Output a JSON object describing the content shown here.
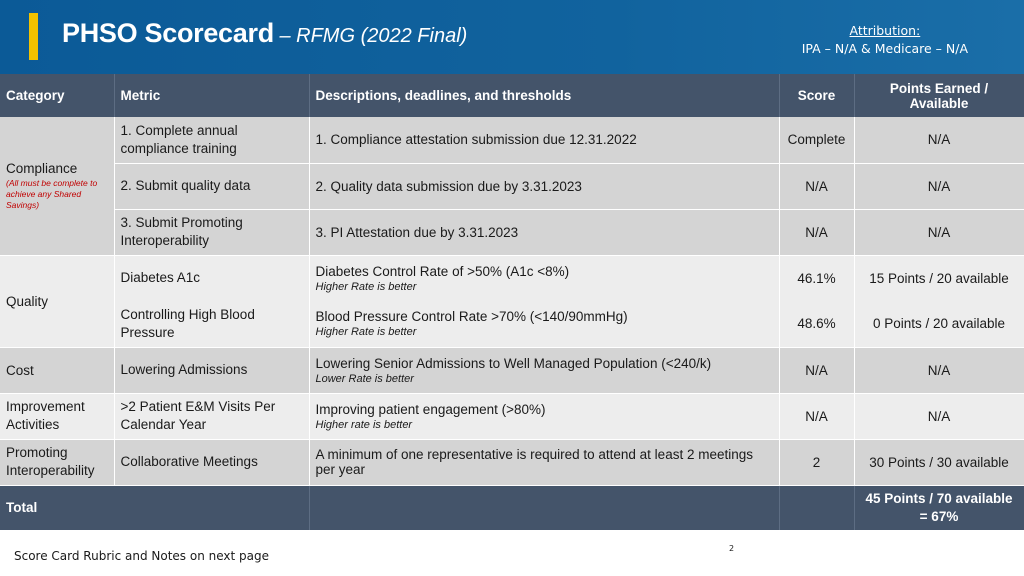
{
  "header": {
    "title_main": "PHSO Scorecard",
    "title_sub": " – RFMG (2022 Final)",
    "attribution_label": "Attribution:",
    "attribution_value": "IPA – N/A & Medicare – N/A",
    "colors": {
      "background": "#0f5e9a",
      "accent": "#f2c200"
    }
  },
  "table": {
    "columns": [
      "Category",
      "Metric",
      "Descriptions, deadlines, and thresholds",
      "Score",
      "Points Earned / Available"
    ],
    "rows": [
      {
        "category": "Compliance",
        "category_note": "(All must be complete to achieve any Shared Savings)",
        "metric": "1. Complete annual compliance training",
        "description": "1. Compliance attestation submission due 12.31.2022",
        "description_note": "",
        "score": "Complete",
        "points": "N/A"
      },
      {
        "category": "",
        "category_note": "",
        "metric": "2. Submit quality data",
        "description": "2. Quality data submission due by 3.31.2023",
        "description_note": "",
        "score": "N/A",
        "points": "N/A"
      },
      {
        "category": "",
        "category_note": "",
        "metric": "3. Submit Promoting Interoperability",
        "description": "3. PI Attestation due by 3.31.2023",
        "description_note": "",
        "score": "N/A",
        "points": "N/A"
      },
      {
        "category": "Quality",
        "category_note": "",
        "metric": "Diabetes A1c",
        "description": "Diabetes Control Rate of >50% (A1c <8%)",
        "description_note": "Higher Rate is better",
        "score": "46.1%",
        "points": "15 Points / 20 available"
      },
      {
        "category": "",
        "category_note": "",
        "metric": "Controlling High Blood Pressure",
        "description": "Blood Pressure Control Rate  >70% (<140/90mmHg)",
        "description_note": "Higher Rate is better",
        "score": "48.6%",
        "points": "0 Points  / 20 available"
      },
      {
        "category": "Cost",
        "category_note": "",
        "metric": " Lowering Admissions",
        "description": "Lowering Senior Admissions to Well Managed Population (<240/k)",
        "description_note": "Lower Rate is better",
        "score": "N/A",
        "points": "N/A"
      },
      {
        "category": "Improvement Activities",
        "category_note": "",
        "metric": " >2 Patient E&M Visits Per Calendar Year",
        "description": "Improving patient engagement (>80%)",
        "description_note": "Higher rate is better",
        "score": "N/A",
        "points": "N/A"
      },
      {
        "category": "Promoting Interoperability",
        "category_note": "",
        "metric": "Collaborative Meetings",
        "description": "A minimum of one representative is required to attend at least 2 meetings per year",
        "description_note": "",
        "score": "2",
        "points": "30 Points / 30 available"
      }
    ],
    "total": {
      "label": "Total",
      "points": "45 Points / 70 available = 67%"
    },
    "colors": {
      "header": "#44546a",
      "row_gray": "#d4d4d4",
      "row_light": "#ededed",
      "note_red": "#c00000"
    }
  },
  "footer": {
    "note": "Score Card Rubric and Notes on next page",
    "page_number": "2"
  }
}
